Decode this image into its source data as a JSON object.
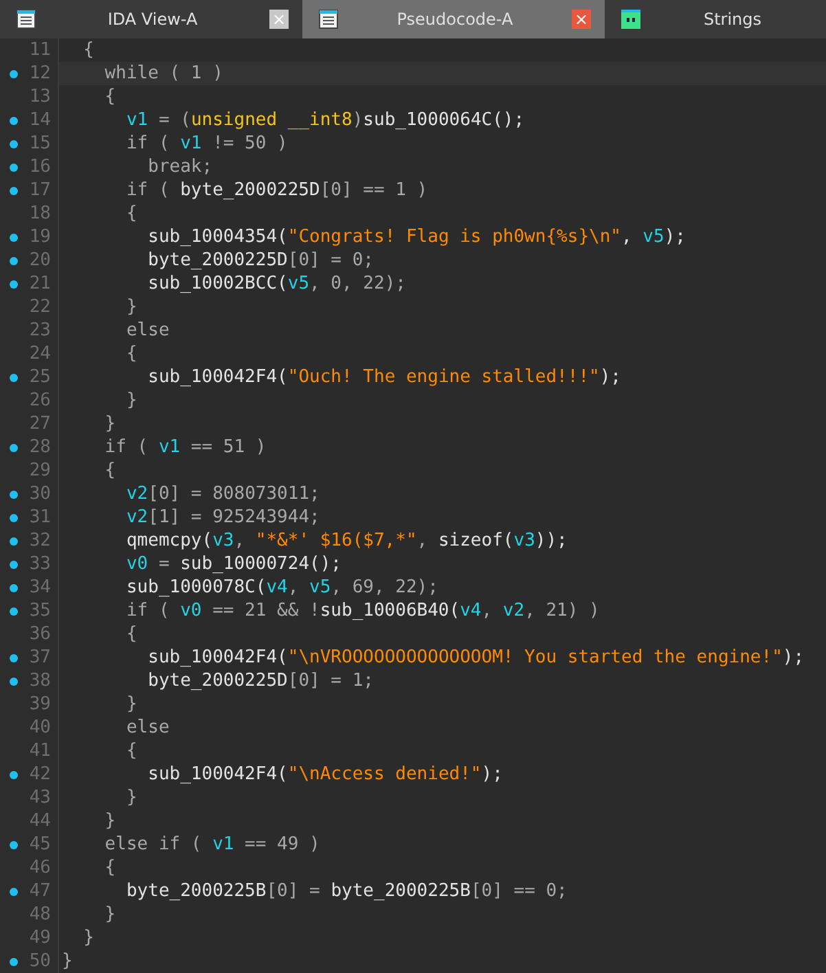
{
  "tabs": [
    {
      "title": "IDA View-A",
      "kind": "window",
      "selected": false,
      "close": "×"
    },
    {
      "title": "Pseudocode-A",
      "kind": "window",
      "selected": true,
      "close": "×"
    },
    {
      "title": "Strings",
      "kind": "strings",
      "selected": false
    }
  ],
  "lines": [
    {
      "number": "11",
      "marker": false,
      "current": false,
      "tokens": [
        {
          "kind": "plain",
          "text": "  {"
        }
      ]
    },
    {
      "number": "12",
      "marker": true,
      "current": true,
      "tokens": [
        {
          "kind": "plain",
          "text": "    while ( 1 )"
        }
      ]
    },
    {
      "number": "13",
      "marker": false,
      "current": false,
      "tokens": [
        {
          "kind": "plain",
          "text": "    {"
        }
      ]
    },
    {
      "number": "14",
      "marker": true,
      "current": false,
      "tokens": [
        {
          "kind": "var",
          "text": "      v1"
        },
        {
          "kind": "plain",
          "text": " = ("
        },
        {
          "kind": "type",
          "text": "unsigned __int8"
        },
        {
          "kind": "plain",
          "text": ")"
        },
        {
          "kind": "ident",
          "text": "sub_1000064C();"
        }
      ]
    },
    {
      "number": "15",
      "marker": true,
      "current": false,
      "tokens": [
        {
          "kind": "plain",
          "text": "      if ( "
        },
        {
          "kind": "var",
          "text": "v1"
        },
        {
          "kind": "plain",
          "text": " != 50 )"
        }
      ]
    },
    {
      "number": "16",
      "marker": true,
      "current": false,
      "tokens": [
        {
          "kind": "plain",
          "text": "        break;"
        }
      ]
    },
    {
      "number": "17",
      "marker": true,
      "current": false,
      "tokens": [
        {
          "kind": "plain",
          "text": "      if ( "
        },
        {
          "kind": "ident",
          "text": "byte_2000225D"
        },
        {
          "kind": "plain",
          "text": "[0] == 1 )"
        }
      ]
    },
    {
      "number": "18",
      "marker": false,
      "current": false,
      "tokens": [
        {
          "kind": "plain",
          "text": "      {"
        }
      ]
    },
    {
      "number": "19",
      "marker": true,
      "current": false,
      "tokens": [
        {
          "kind": "ident",
          "text": "        sub_10004354("
        },
        {
          "kind": "string",
          "text": "\"Congrats! Flag is ph0wn{%s}\\n\""
        },
        {
          "kind": "ident",
          "text": ", "
        },
        {
          "kind": "var",
          "text": "v5"
        },
        {
          "kind": "ident",
          "text": ");"
        }
      ]
    },
    {
      "number": "20",
      "marker": true,
      "current": false,
      "tokens": [
        {
          "kind": "ident",
          "text": "        byte_2000225D"
        },
        {
          "kind": "plain",
          "text": "[0] = 0;"
        }
      ]
    },
    {
      "number": "21",
      "marker": true,
      "current": false,
      "tokens": [
        {
          "kind": "ident",
          "text": "        sub_10002BCC("
        },
        {
          "kind": "var",
          "text": "v5"
        },
        {
          "kind": "plain",
          "text": ", 0, 22);"
        }
      ]
    },
    {
      "number": "22",
      "marker": false,
      "current": false,
      "tokens": [
        {
          "kind": "plain",
          "text": "      }"
        }
      ]
    },
    {
      "number": "23",
      "marker": false,
      "current": false,
      "tokens": [
        {
          "kind": "plain",
          "text": "      else"
        }
      ]
    },
    {
      "number": "24",
      "marker": false,
      "current": false,
      "tokens": [
        {
          "kind": "plain",
          "text": "      {"
        }
      ]
    },
    {
      "number": "25",
      "marker": true,
      "current": false,
      "tokens": [
        {
          "kind": "ident",
          "text": "        sub_100042F4("
        },
        {
          "kind": "string",
          "text": "\"Ouch! The engine stalled!!!\""
        },
        {
          "kind": "ident",
          "text": ");"
        }
      ]
    },
    {
      "number": "26",
      "marker": false,
      "current": false,
      "tokens": [
        {
          "kind": "plain",
          "text": "      }"
        }
      ]
    },
    {
      "number": "27",
      "marker": false,
      "current": false,
      "tokens": [
        {
          "kind": "plain",
          "text": "    }"
        }
      ]
    },
    {
      "number": "28",
      "marker": true,
      "current": false,
      "tokens": [
        {
          "kind": "plain",
          "text": "    if ( "
        },
        {
          "kind": "var",
          "text": "v1"
        },
        {
          "kind": "plain",
          "text": " == 51 )"
        }
      ]
    },
    {
      "number": "29",
      "marker": false,
      "current": false,
      "tokens": [
        {
          "kind": "plain",
          "text": "    {"
        }
      ]
    },
    {
      "number": "30",
      "marker": true,
      "current": false,
      "tokens": [
        {
          "kind": "var",
          "text": "      v2"
        },
        {
          "kind": "plain",
          "text": "[0] = 808073011;"
        }
      ]
    },
    {
      "number": "31",
      "marker": true,
      "current": false,
      "tokens": [
        {
          "kind": "var",
          "text": "      v2"
        },
        {
          "kind": "plain",
          "text": "[1] = 925243944;"
        }
      ]
    },
    {
      "number": "32",
      "marker": true,
      "current": false,
      "tokens": [
        {
          "kind": "ident",
          "text": "      qmemcpy("
        },
        {
          "kind": "var",
          "text": "v3"
        },
        {
          "kind": "plain",
          "text": ", "
        },
        {
          "kind": "string",
          "text": "\"*&*' $16($7,*\""
        },
        {
          "kind": "plain",
          "text": ", "
        },
        {
          "kind": "ident",
          "text": "sizeof("
        },
        {
          "kind": "var",
          "text": "v3"
        },
        {
          "kind": "ident",
          "text": "));"
        }
      ]
    },
    {
      "number": "33",
      "marker": true,
      "current": false,
      "tokens": [
        {
          "kind": "var",
          "text": "      v0"
        },
        {
          "kind": "plain",
          "text": " = "
        },
        {
          "kind": "ident",
          "text": "sub_10000724();"
        }
      ]
    },
    {
      "number": "34",
      "marker": true,
      "current": false,
      "tokens": [
        {
          "kind": "ident",
          "text": "      sub_1000078C("
        },
        {
          "kind": "var",
          "text": "v4"
        },
        {
          "kind": "plain",
          "text": ", "
        },
        {
          "kind": "var",
          "text": "v5"
        },
        {
          "kind": "plain",
          "text": ", 69, 22);"
        }
      ]
    },
    {
      "number": "35",
      "marker": true,
      "current": false,
      "tokens": [
        {
          "kind": "plain",
          "text": "      if ( "
        },
        {
          "kind": "var",
          "text": "v0"
        },
        {
          "kind": "plain",
          "text": " == 21 && !"
        },
        {
          "kind": "ident",
          "text": "sub_10006B40("
        },
        {
          "kind": "var",
          "text": "v4"
        },
        {
          "kind": "plain",
          "text": ", "
        },
        {
          "kind": "var",
          "text": "v2"
        },
        {
          "kind": "plain",
          "text": ", 21) )"
        }
      ]
    },
    {
      "number": "36",
      "marker": false,
      "current": false,
      "tokens": [
        {
          "kind": "plain",
          "text": "      {"
        }
      ]
    },
    {
      "number": "37",
      "marker": true,
      "current": false,
      "tokens": [
        {
          "kind": "ident",
          "text": "        sub_100042F4("
        },
        {
          "kind": "string",
          "text": "\"\\nVROOOOOOOOOOOOOOM! You started the engine!\""
        },
        {
          "kind": "ident",
          "text": ");"
        }
      ]
    },
    {
      "number": "38",
      "marker": true,
      "current": false,
      "tokens": [
        {
          "kind": "ident",
          "text": "        byte_2000225D"
        },
        {
          "kind": "plain",
          "text": "[0] = 1;"
        }
      ]
    },
    {
      "number": "39",
      "marker": false,
      "current": false,
      "tokens": [
        {
          "kind": "plain",
          "text": "      }"
        }
      ]
    },
    {
      "number": "40",
      "marker": false,
      "current": false,
      "tokens": [
        {
          "kind": "plain",
          "text": "      else"
        }
      ]
    },
    {
      "number": "41",
      "marker": false,
      "current": false,
      "tokens": [
        {
          "kind": "plain",
          "text": "      {"
        }
      ]
    },
    {
      "number": "42",
      "marker": true,
      "current": false,
      "tokens": [
        {
          "kind": "ident",
          "text": "        sub_100042F4("
        },
        {
          "kind": "string",
          "text": "\"\\nAccess denied!\""
        },
        {
          "kind": "ident",
          "text": ");"
        }
      ]
    },
    {
      "number": "43",
      "marker": false,
      "current": false,
      "tokens": [
        {
          "kind": "plain",
          "text": "      }"
        }
      ]
    },
    {
      "number": "44",
      "marker": false,
      "current": false,
      "tokens": [
        {
          "kind": "plain",
          "text": "    }"
        }
      ]
    },
    {
      "number": "45",
      "marker": true,
      "current": false,
      "tokens": [
        {
          "kind": "plain",
          "text": "    else if ( "
        },
        {
          "kind": "var",
          "text": "v1"
        },
        {
          "kind": "plain",
          "text": " == 49 )"
        }
      ]
    },
    {
      "number": "46",
      "marker": false,
      "current": false,
      "tokens": [
        {
          "kind": "plain",
          "text": "    {"
        }
      ]
    },
    {
      "number": "47",
      "marker": true,
      "current": false,
      "tokens": [
        {
          "kind": "ident",
          "text": "      byte_2000225B"
        },
        {
          "kind": "plain",
          "text": "[0] = "
        },
        {
          "kind": "ident",
          "text": "byte_2000225B"
        },
        {
          "kind": "plain",
          "text": "[0] == 0;"
        }
      ]
    },
    {
      "number": "48",
      "marker": false,
      "current": false,
      "tokens": [
        {
          "kind": "plain",
          "text": "    }"
        }
      ]
    },
    {
      "number": "49",
      "marker": false,
      "current": false,
      "tokens": [
        {
          "kind": "plain",
          "text": "  }"
        }
      ]
    },
    {
      "number": "50",
      "marker": true,
      "current": false,
      "tokens": [
        {
          "kind": "plain",
          "text": "}"
        }
      ]
    }
  ]
}
